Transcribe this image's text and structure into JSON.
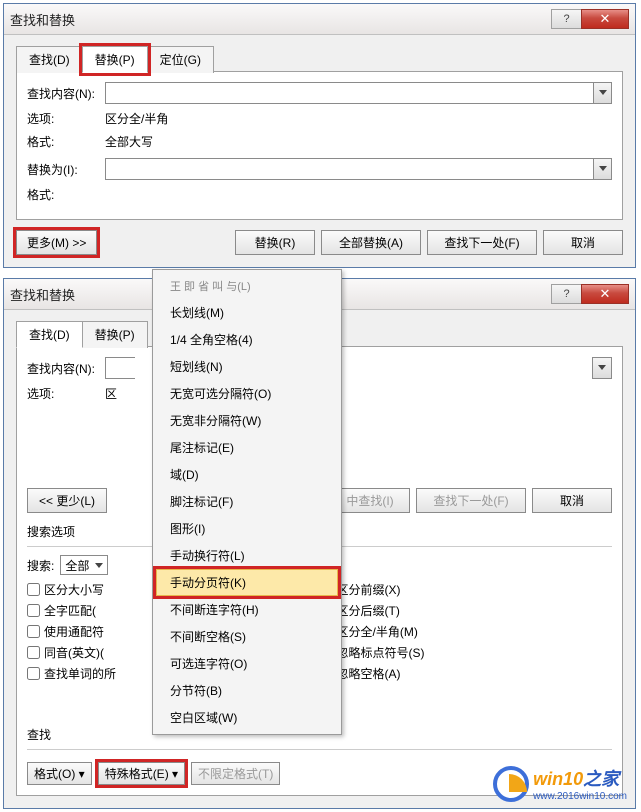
{
  "dialog1": {
    "title": "查找和替换",
    "tabs": {
      "find": "查找(D)",
      "replace": "替换(P)",
      "goto": "定位(G)"
    },
    "find_label": "查找内容(N):",
    "options_label": "选项:",
    "options_value": "区分全/半角",
    "format_label": "格式:",
    "format_value": "全部大写",
    "replace_label": "替换为(I):",
    "format2_label": "格式:",
    "buttons": {
      "more": "更多(M) >>",
      "replace": "替换(R)",
      "replace_all": "全部替换(A)",
      "find_next": "查找下一处(F)",
      "cancel": "取消"
    }
  },
  "dialog2": {
    "title": "查找和替换",
    "tabs": {
      "find": "查找(D)",
      "replace": "替换(P)"
    },
    "find_label": "查找内容(N):",
    "options_label": "选项:",
    "options_value": "区",
    "buttons": {
      "less": "<< 更少(L)",
      "search_in": "中查找(I)",
      "find_next": "查找下一处(F)",
      "cancel": "取消"
    },
    "search_options_title": "搜索选项",
    "search_label": "搜索:",
    "search_value": "全部",
    "checks_left": [
      {
        "label": "区分大小写",
        "checked": false
      },
      {
        "label": "全字匹配(",
        "checked": false
      },
      {
        "label": "使用通配符",
        "checked": false
      },
      {
        "label": "同音(英文)(",
        "checked": false
      },
      {
        "label": "查找单词的所",
        "checked": false
      }
    ],
    "checks_right": [
      {
        "label": "区分前缀(X)",
        "checked": false
      },
      {
        "label": "区分后缀(T)",
        "checked": false
      },
      {
        "label": "区分全/半角(M)",
        "checked": true
      },
      {
        "label": "忽略标点符号(S)",
        "checked": false
      },
      {
        "label": "忽略空格(A)",
        "checked": false
      }
    ],
    "find_section": "查找",
    "footer": {
      "format": "格式(O)",
      "special": "特殊格式(E)",
      "no_format": "不限定格式(T)"
    }
  },
  "menu_items": [
    "长划线(M)",
    "1/4 全角空格(4)",
    "短划线(N)",
    "无宽可选分隔符(O)",
    "无宽非分隔符(W)",
    "尾注标记(E)",
    "域(D)",
    "脚注标记(F)",
    "图形(I)",
    "手动换行符(L)",
    "手动分页符(K)",
    "不间断连字符(H)",
    "不间断空格(S)",
    "可选连字符(O)",
    "分节符(B)",
    "空白区域(W)"
  ],
  "menu_truncated_top": "王 即 省 叫 与(L)",
  "watermark": {
    "brand_a": "win10",
    "brand_b": "之家",
    "url": "www.2016win10.com"
  }
}
